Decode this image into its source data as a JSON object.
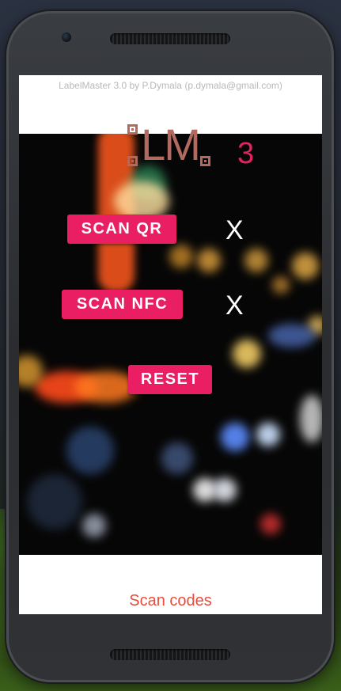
{
  "app": {
    "credit": "LabelMaster 3.0 by P.Dymala (p.dymala@gmail.com)",
    "logo_text": "LM",
    "counter": "3"
  },
  "actions": {
    "scan_qr": {
      "label": "SCAN QR",
      "status": "X"
    },
    "scan_nfc": {
      "label": "SCAN NFC",
      "status": "X"
    },
    "reset": {
      "label": "RESET"
    }
  },
  "footer": {
    "link": "Scan codes"
  },
  "colors": {
    "accent": "#e91e63",
    "counter": "#e0245e",
    "logo": "#b26a60",
    "footer_link": "#e74c3c"
  }
}
